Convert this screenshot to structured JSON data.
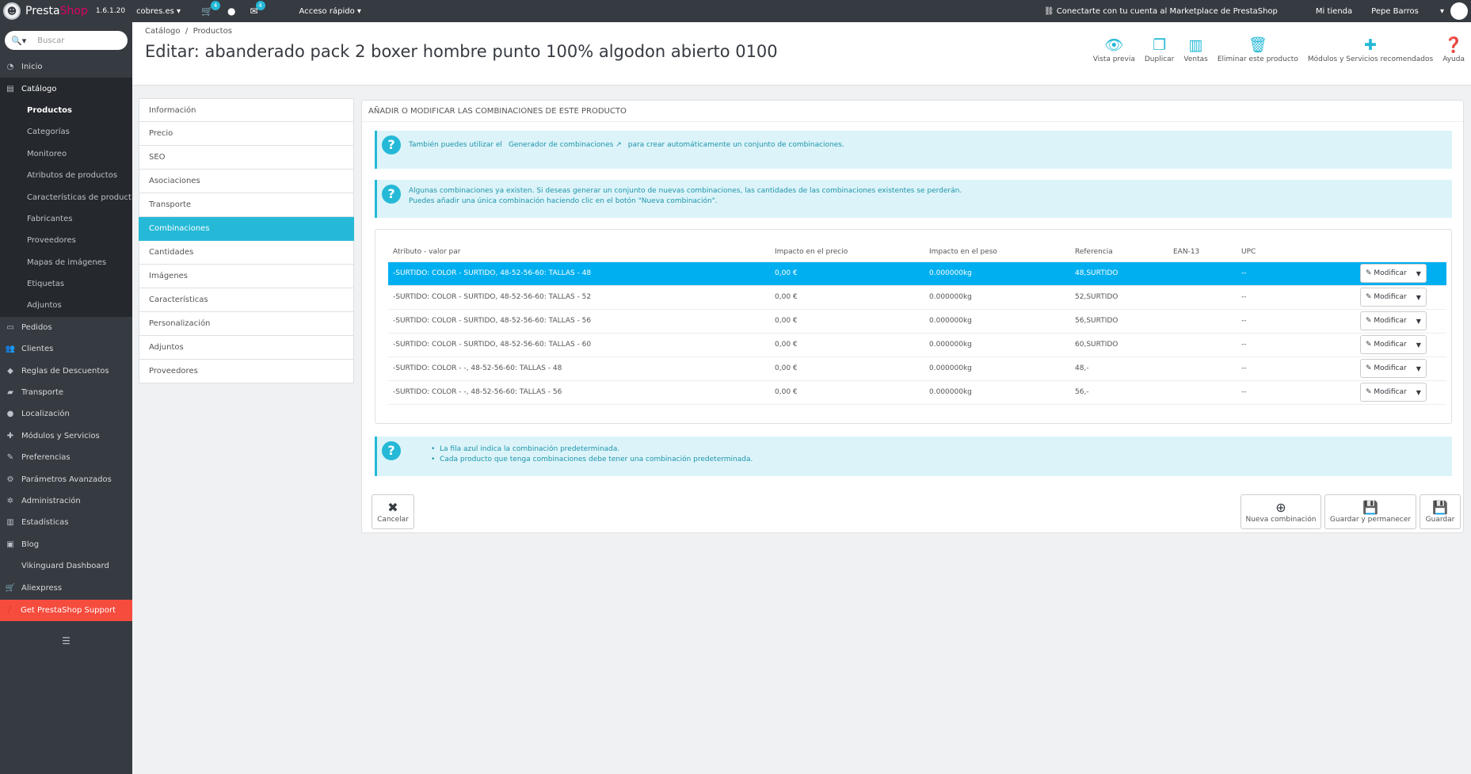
{
  "topbar": {
    "brand_a": "Presta",
    "brand_b": "Shop",
    "version": "1.6.1.20",
    "shop": "cobres.es",
    "cart_badge": "4",
    "msg_badge": "4",
    "quick_access": "Acceso rápido",
    "marketplace": "Conectarte con tu cuenta al Marketplace de PrestaShop",
    "my_shop": "Mi tienda",
    "user": "Pepe Barros"
  },
  "sidebar": {
    "search_placeholder": "Buscar",
    "items": [
      {
        "label": "Inicio",
        "icon": "dashboard-icon"
      },
      {
        "label": "Catálogo",
        "icon": "book-icon"
      },
      {
        "label": "Pedidos",
        "icon": "credit-card-icon"
      },
      {
        "label": "Clientes",
        "icon": "users-icon"
      },
      {
        "label": "Reglas de Descuentos",
        "icon": "tags-icon"
      },
      {
        "label": "Transporte",
        "icon": "truck-icon"
      },
      {
        "label": "Localización",
        "icon": "globe-icon"
      },
      {
        "label": "Módulos y Servicios",
        "icon": "puzzle-icon"
      },
      {
        "label": "Preferencias",
        "icon": "wrench-icon"
      },
      {
        "label": "Parámetros Avanzados",
        "icon": "cogs-icon"
      },
      {
        "label": "Administración",
        "icon": "cog-icon"
      },
      {
        "label": "Estadísticas",
        "icon": "bar-chart-icon"
      },
      {
        "label": "Blog",
        "icon": "image-icon"
      },
      {
        "label": "Vikinguard Dashboard",
        "icon": ""
      },
      {
        "label": "Aliexpress",
        "icon": "cart-icon"
      }
    ],
    "catalog_sub": [
      "Productos",
      "Categorías",
      "Monitoreo",
      "Atributos de productos",
      "Características de product...",
      "Fabricantes",
      "Proveedores",
      "Mapas de imágenes",
      "Etiquetas",
      "Adjuntos"
    ],
    "support": "Get PrestaShop Support"
  },
  "header": {
    "crumb_1": "Catálogo",
    "crumb_sep": "/",
    "crumb_2": "Productos",
    "title": "Editar: abanderado pack 2 boxer hombre punto 100% algodon abierto 0100",
    "tools": [
      "Vista previa",
      "Duplicar",
      "Ventas",
      "Eliminar este producto",
      "Módulos y Servicios recomendados",
      "Ayuda"
    ]
  },
  "tabs": [
    "Información",
    "Precio",
    "SEO",
    "Asociaciones",
    "Transporte",
    "Combinaciones",
    "Cantidades",
    "Imágenes",
    "Características",
    "Personalización",
    "Adjuntos",
    "Proveedores"
  ],
  "panel": {
    "heading": "Añadir o modificar las combinaciones de este producto",
    "alert1_pre": "También puedes utilizar el",
    "alert1_link": "Generador de combinaciones",
    "alert1_post": "para crear automáticamente un conjunto de combinaciones.",
    "alert2_l1": "Algunas combinaciones ya existen. Si deseas generar un conjunto de nuevas combinaciones, las cantidades de las combinaciones existentes se perderán.",
    "alert2_l2": "Puedes añadir una única combinación haciendo clic en el botón \"Nueva combinación\".",
    "alert3_l1": "La fila azul indica la combinación predeterminada.",
    "alert3_l2": "Cada producto que tenga combinaciones debe tener una combinación predeterminada."
  },
  "table": {
    "headers": [
      "Atributo - valor par",
      "Impacto en el precio",
      "Impacto en el peso",
      "Referencia",
      "EAN-13",
      "UPC"
    ],
    "edit_label": "Modificar",
    "rows": [
      [
        "-SURTIDO: COLOR - SURTIDO, 48-52-56-60: TALLAS - 48",
        "0,00 €",
        "0.000000kg",
        "48,SURTIDO",
        "",
        "--"
      ],
      [
        "-SURTIDO: COLOR - SURTIDO, 48-52-56-60: TALLAS - 52",
        "0,00 €",
        "0.000000kg",
        "52,SURTIDO",
        "",
        "--"
      ],
      [
        "-SURTIDO: COLOR - SURTIDO, 48-52-56-60: TALLAS - 56",
        "0,00 €",
        "0.000000kg",
        "56,SURTIDO",
        "",
        "--"
      ],
      [
        "-SURTIDO: COLOR - SURTIDO, 48-52-56-60: TALLAS - 60",
        "0,00 €",
        "0.000000kg",
        "60,SURTIDO",
        "",
        "--"
      ],
      [
        "-SURTIDO: COLOR - -, 48-52-56-60: TALLAS - 48",
        "0,00 €",
        "0.000000kg",
        "48,-",
        "",
        "--"
      ],
      [
        "-SURTIDO: COLOR - -, 48-52-56-60: TALLAS - 56",
        "0,00 €",
        "0.000000kg",
        "56,-",
        "",
        "--"
      ]
    ]
  },
  "footer": {
    "cancel": "Cancelar",
    "new_combination": "Nueva combinación",
    "save_stay": "Guardar y permanecer",
    "save": "Guardar"
  },
  "colors": {
    "accent": "#25b9d7",
    "default_row": "#00aff0",
    "support": "#f54c3e",
    "sidebar": "#363a41"
  }
}
